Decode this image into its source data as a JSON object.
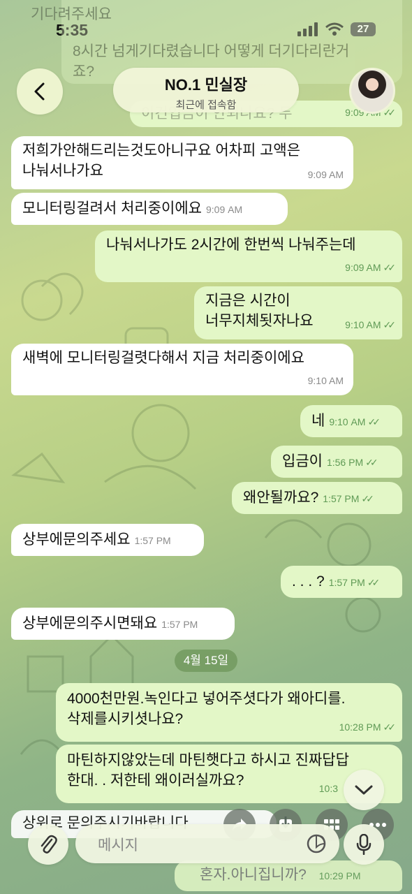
{
  "status": {
    "time": "5:35",
    "battery": "27"
  },
  "header": {
    "title": "NO.1 민실장",
    "subtitle": "최근에 접속함",
    "avatar_icon": "profile-photo"
  },
  "top_ghost": {
    "line1": "기다려주세요",
    "line2": "8시간 넘게기다렸습니다 어떻게 더기다리란거",
    "line3": "죠?",
    "line4": "이건입금이 안되나요? 두",
    "time": "9:09 AM"
  },
  "messages": [
    {
      "dir": "in",
      "lines": [
        "저희가안해드리는것도아니구요 어차피 고액은",
        "나눠서나가요"
      ],
      "time": "9:09 AM"
    },
    {
      "dir": "in",
      "lines": [
        "모니터링걸려서 처리중이에요"
      ],
      "time": "9:09 AM"
    },
    {
      "dir": "out",
      "lines": [
        "나눠서나가도 2시간에 한번씩 나눠주는데"
      ],
      "time": "9:09 AM"
    },
    {
      "dir": "out",
      "lines": [
        "지금은 시간이",
        "너무지체됫자나요"
      ],
      "time": "9:10 AM"
    },
    {
      "dir": "in",
      "lines": [
        "새벽에 모니터링걸렷다해서 지금 처리중이에요"
      ],
      "time": "9:10 AM"
    },
    {
      "dir": "out",
      "lines": [
        "네"
      ],
      "time": "9:10 AM"
    },
    {
      "dir": "out",
      "lines": [
        "입금이"
      ],
      "time": "1:56 PM"
    },
    {
      "dir": "out",
      "lines": [
        "왜안될까요?"
      ],
      "time": "1:57 PM"
    },
    {
      "dir": "in",
      "lines": [
        "상부에문의주세요"
      ],
      "time": "1:57 PM"
    },
    {
      "dir": "out",
      "lines": [
        ". . . ?"
      ],
      "time": "1:57 PM"
    },
    {
      "dir": "in",
      "lines": [
        "상부에문의주시면돼요"
      ],
      "time": "1:57 PM"
    },
    {
      "dir": "out",
      "lines": [
        "4000천만원.녹인다고 넣어주셧다가 왜아디를.",
        "삭제를시키셧나요?"
      ],
      "time": "10:28 PM"
    },
    {
      "dir": "out",
      "lines": [
        "마틴하지않았는데 마틴햇다고 하시고 진짜답답",
        "한대. . 저한테 왜이러실까요?"
      ],
      "time": "10:3"
    }
  ],
  "date_divider": "4월 15일",
  "bottom_ghost": {
    "in_text": "상위로 문의주시기바랍니다",
    "out_text": "혼자.아니집니까?",
    "out_time": "10:29 PM"
  },
  "composer": {
    "placeholder": "메시지"
  },
  "colors": {
    "incoming": "#ffffff",
    "outgoing": "#e3f7c7",
    "time_out": "#5f9a55"
  }
}
